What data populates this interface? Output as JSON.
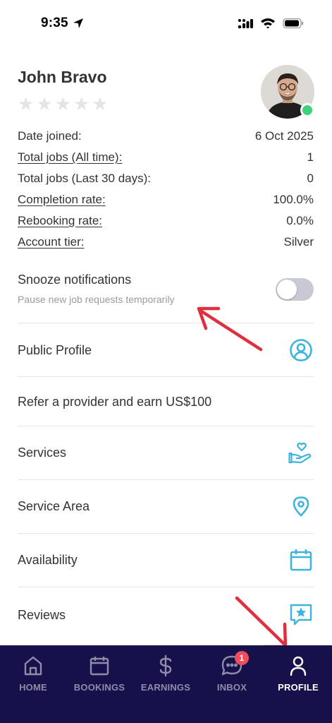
{
  "status_bar": {
    "time": "9:35"
  },
  "profile": {
    "name": "John Bravo",
    "rating_stars": 5,
    "online": true
  },
  "stats": [
    {
      "label": "Date joined:",
      "value": "6 Oct 2025",
      "underlined": false
    },
    {
      "label": "Total jobs (All time):",
      "value": "1",
      "underlined": true
    },
    {
      "label": "Total jobs (Last 30 days):",
      "value": "0",
      "underlined": false
    },
    {
      "label": "Completion rate:",
      "value": "100.0%",
      "underlined": true
    },
    {
      "label": "Rebooking rate:",
      "value": "0.0%",
      "underlined": true
    },
    {
      "label": "Account tier:",
      "value": "Silver",
      "underlined": true
    }
  ],
  "snooze": {
    "title": "Snooze notifications",
    "subtitle": "Pause new job requests temporarily",
    "enabled": false
  },
  "menu": {
    "public_profile": "Public Profile",
    "refer": "Refer a provider and earn US$100",
    "services": "Services",
    "service_area": "Service Area",
    "availability": "Availability",
    "reviews": "Reviews"
  },
  "colors": {
    "accent_icon": "#3db3dd",
    "nav_bg": "#16114a",
    "nav_inactive": "#8e8ca8",
    "toggle_off": "#c8cad3",
    "online": "#3ed37a",
    "annotation_arrow": "#e0303e"
  },
  "bottom_nav": {
    "home": "HOME",
    "bookings": "BOOKINGS",
    "earnings": "EARNINGS",
    "inbox": "INBOX",
    "inbox_badge": "1",
    "profile": "PROFILE",
    "active": "profile"
  }
}
